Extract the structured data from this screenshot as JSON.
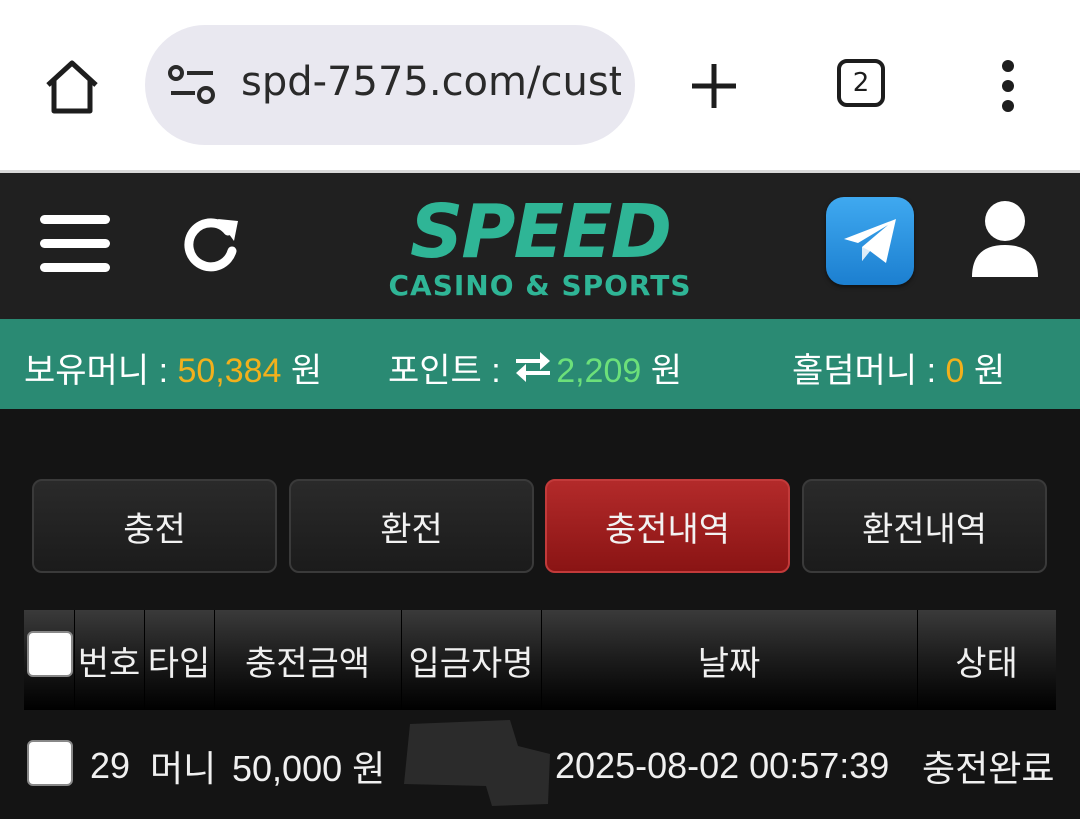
{
  "browser": {
    "url": "spd-7575.com/cust",
    "tab_count": "2"
  },
  "header": {
    "logo_main": "SPEED",
    "logo_sub": "CASINO & SPORTS"
  },
  "balance": {
    "money_label": "보유머니 : ",
    "money_value": "50,384",
    "money_unit": " 원",
    "point_label": "포인트 : ",
    "point_value": "2,209",
    "point_unit": " 원",
    "holdem_label": "홀덤머니 : ",
    "holdem_value": "0",
    "holdem_unit": " 원"
  },
  "tabs": [
    {
      "label": "충전",
      "active": false
    },
    {
      "label": "환전",
      "active": false
    },
    {
      "label": "충전내역",
      "active": true
    },
    {
      "label": "환전내역",
      "active": false
    }
  ],
  "table": {
    "headers": [
      "번호",
      "타입",
      "충전금액",
      "입금자명",
      "날짜",
      "상태"
    ],
    "rows": [
      {
        "no": "29",
        "type": "머니",
        "amount": "50,000 원",
        "depositor": "",
        "date": "2025-08-02 00:57:39",
        "status": "충전완료"
      }
    ]
  },
  "colors": {
    "accent_green": "#2a8a73",
    "logo_green": "#2fb596",
    "active_tab_red": "#b32a2a",
    "money_yellow": "#f2b01c",
    "point_green": "#6ce07a"
  }
}
